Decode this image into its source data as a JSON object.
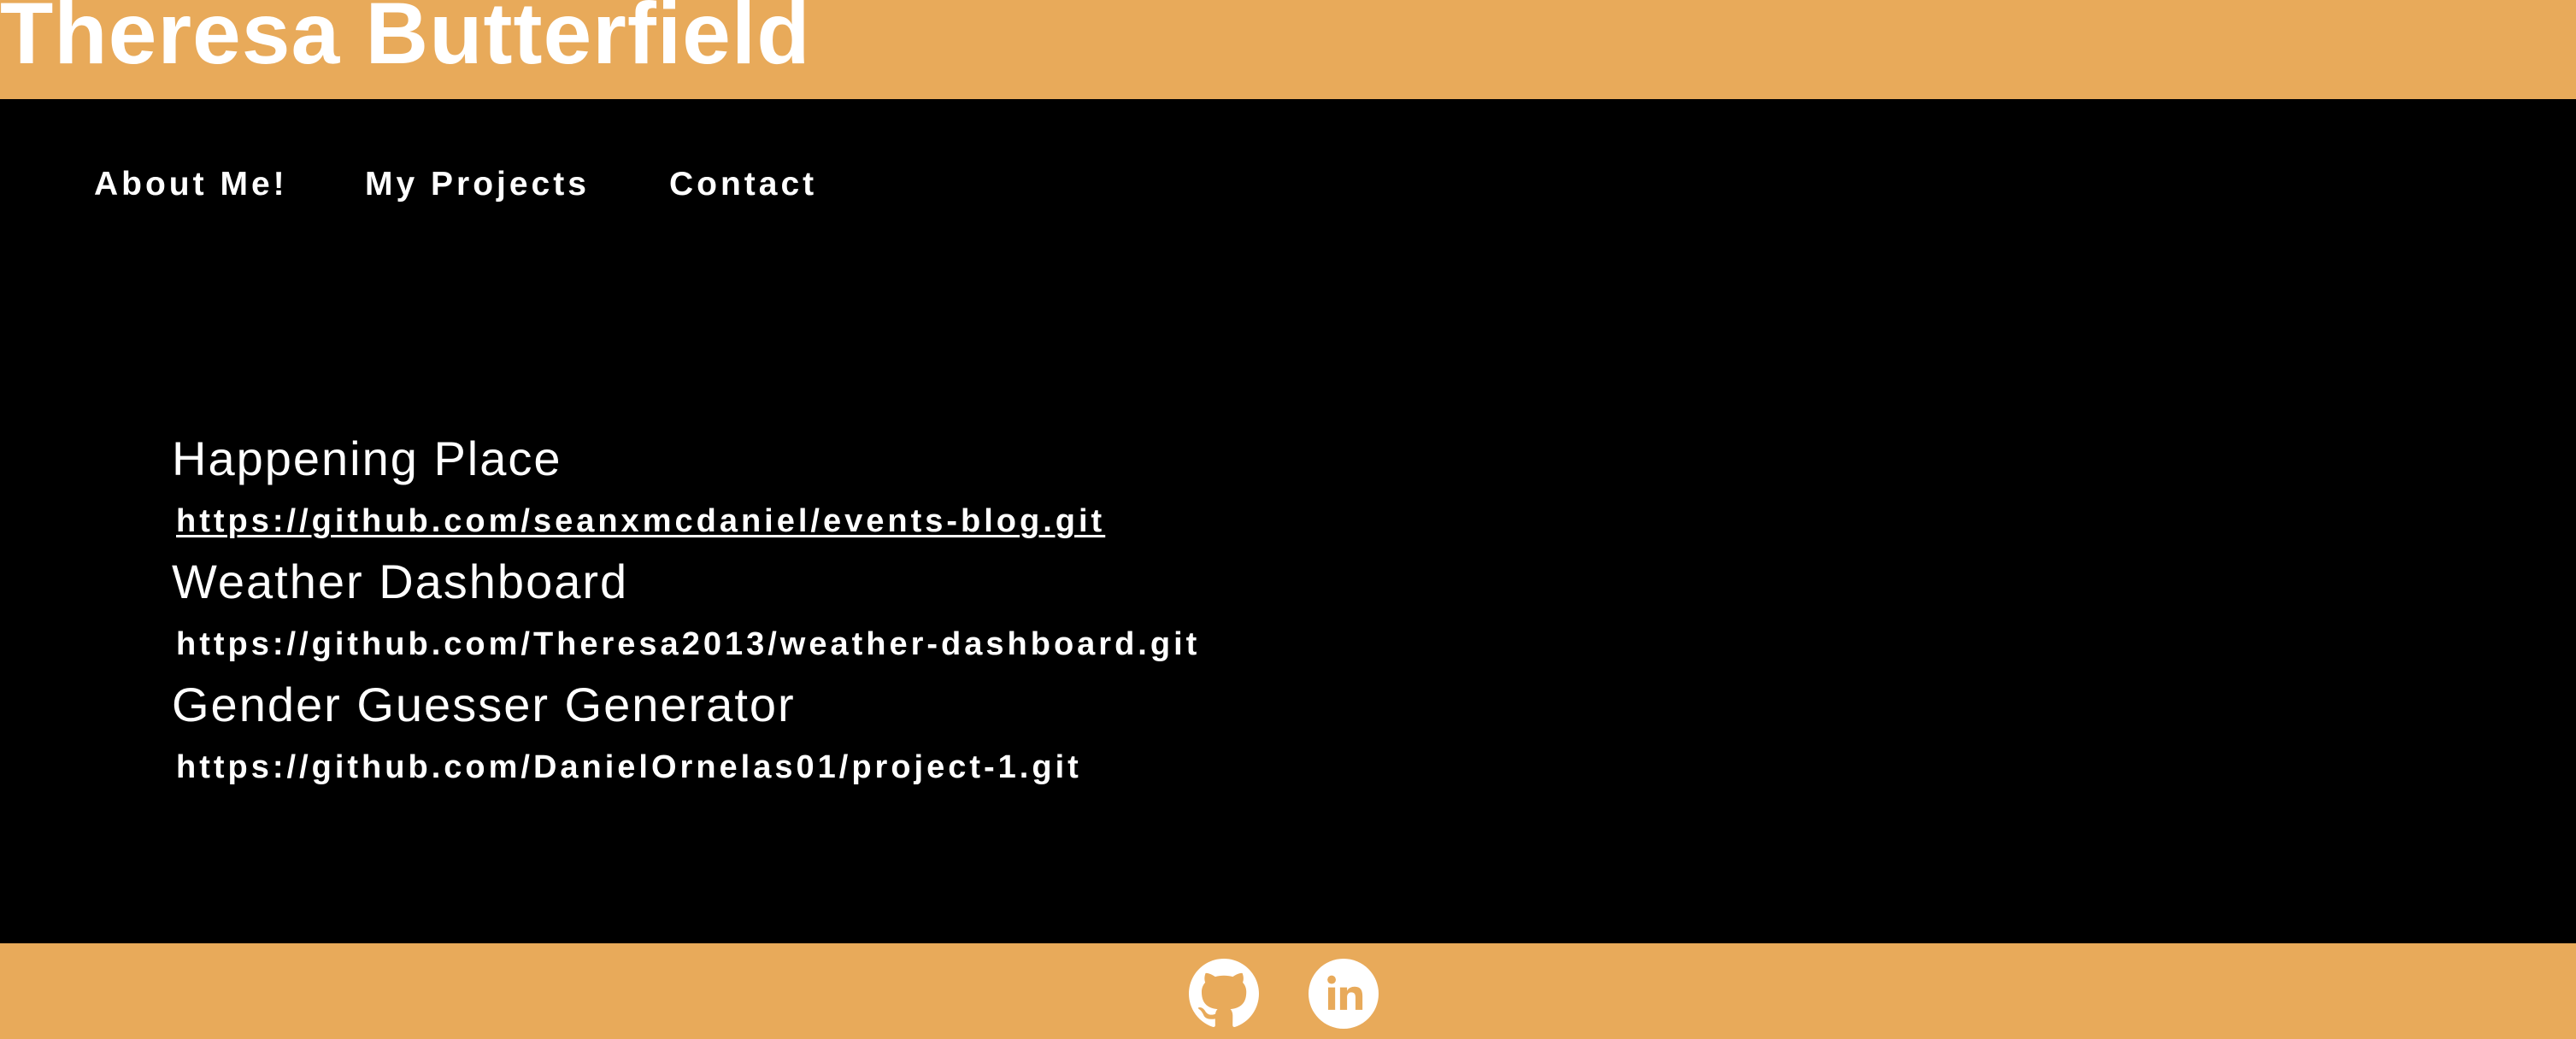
{
  "header": {
    "title": "Theresa Butterfield"
  },
  "nav": {
    "items": [
      {
        "label": "About Me!"
      },
      {
        "label": "My Projects"
      },
      {
        "label": "Contact"
      }
    ]
  },
  "projects": [
    {
      "title": "Happening Place",
      "link": "https://github.com/seanxmcdaniel/events-blog.git"
    },
    {
      "title": "Weather Dashboard",
      "link": "https://github.com/Theresa2013/weather-dashboard.git"
    },
    {
      "title": "Gender Guesser Generator",
      "link": "https://github.com/DanielOrnelas01/project-1.git"
    }
  ],
  "footer": {
    "icons": [
      "github-icon",
      "linkedin-icon"
    ]
  },
  "colors": {
    "accent": "#e8aa5a",
    "background": "#000000",
    "text": "#ffffff"
  }
}
